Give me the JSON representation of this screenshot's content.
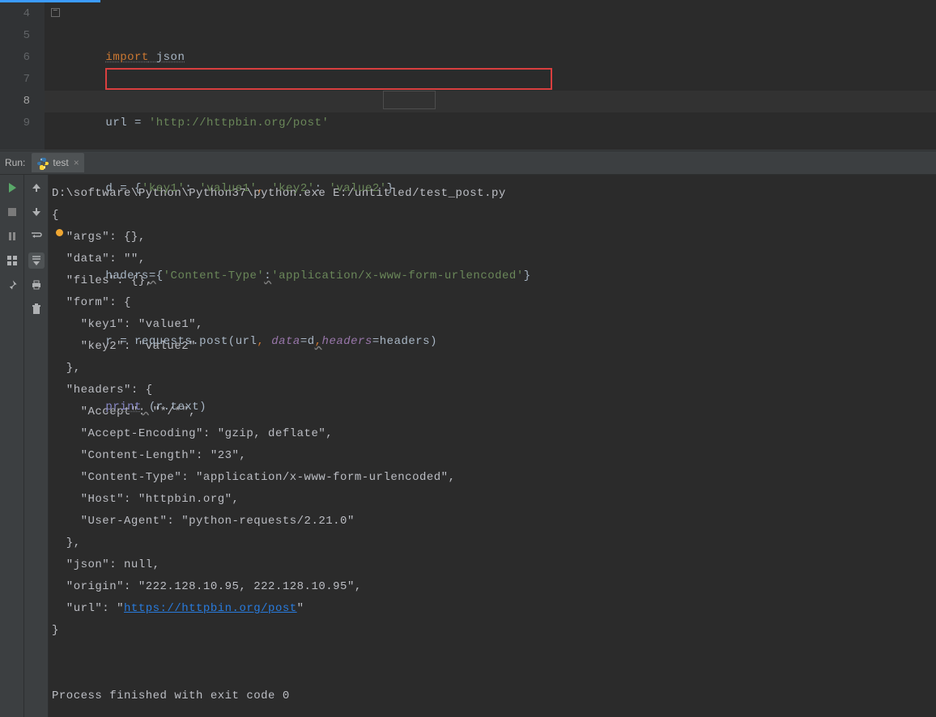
{
  "editor": {
    "line_numbers": [
      "4",
      "5",
      "6",
      "7",
      "8",
      "9"
    ],
    "active_line_index": 4,
    "code": {
      "l4": {
        "import_kw": "import",
        "module": " json"
      },
      "l5": {
        "lhs": "url ",
        "eq": "=",
        "sp": " ",
        "str": "'http://httpbin.org/post'"
      },
      "l6": {
        "lhs": "d ",
        "eq": "=",
        "sp": " ",
        "open": "{",
        "k1": "'key1'",
        "c1": ": ",
        "v1": "'value1'",
        "comma": ",",
        "sp2": " ",
        "k2": "'key2'",
        "c2": ": ",
        "v2": "'value2'",
        "close": "}"
      },
      "l7": {
        "lhs": "headers",
        "eq": "=",
        "open": "{",
        "k": "'Content-Type'",
        "colon": ":",
        "v": "'application/x-www-form-urlencoded'",
        "close": "}"
      },
      "l8": {
        "lhs": "r ",
        "eq": "=",
        "sp": " ",
        "obj": "requests",
        "dot": ".",
        "meth": "post",
        "lp": "(",
        "a1": "url",
        "comma1": ",",
        "sp2": " ",
        "kw1": "data",
        "eq1": "=",
        "v1": "d",
        "comma2": ",",
        "kw2": "headers",
        "eq2": "=",
        "v2": "headers",
        "rp": ")"
      },
      "l9": {
        "fn": "print",
        "sp": " ",
        "lp": "(",
        "obj": "r",
        "dot": ".",
        "attr": "text",
        "rp": ")"
      }
    }
  },
  "run": {
    "label": "Run:",
    "tab_name": "test"
  },
  "console": {
    "cmd": "D:\\software\\Python\\Python37\\python.exe E:/untitled/test_post.py",
    "lines": [
      "{",
      "  \"args\": {}, ",
      "  \"data\": \"\", ",
      "  \"files\": {}, ",
      "  \"form\": {",
      "    \"key1\": \"value1\", ",
      "    \"key2\": \"value2\"",
      "  }, ",
      "  \"headers\": {",
      "    \"Accept\": \"*/*\", ",
      "    \"Accept-Encoding\": \"gzip, deflate\", ",
      "    \"Content-Length\": \"23\", ",
      "    \"Content-Type\": \"application/x-www-form-urlencoded\", ",
      "    \"Host\": \"httpbin.org\", ",
      "    \"User-Agent\": \"python-requests/2.21.0\"",
      "  }, ",
      "  \"json\": null, ",
      "  \"origin\": \"222.128.10.95, 222.128.10.95\", "
    ],
    "url_line_prefix": "  \"url\": \"",
    "url_link": "https://httpbin.org/post",
    "url_line_suffix": "\"",
    "close_brace": "}",
    "exit": "Process finished with exit code 0"
  }
}
